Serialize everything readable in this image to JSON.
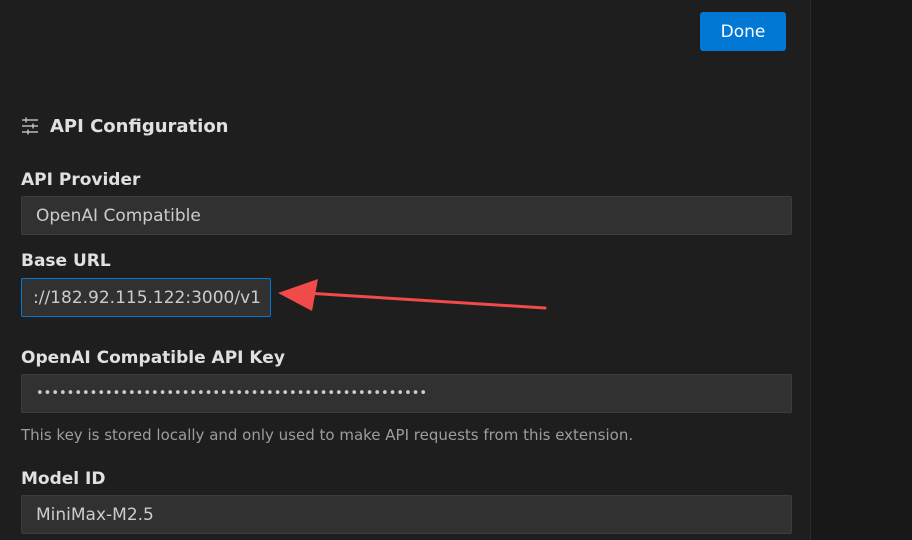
{
  "header": {
    "done_label": "Done"
  },
  "section": {
    "icon": "sliders-icon",
    "title": "API Configuration"
  },
  "fields": {
    "provider": {
      "label": "API Provider",
      "value": "OpenAI Compatible"
    },
    "base_url": {
      "label": "Base URL",
      "value": "://182.92.115.122:3000/v1"
    },
    "api_key": {
      "label": "OpenAI Compatible API Key",
      "value": "•••••••••••••••••••••••••••••••••••••••••••••••••••",
      "help": "This key is stored locally and only used to make API requests from this extension."
    },
    "model_id": {
      "label": "Model ID",
      "value": "MiniMax-M2.5"
    }
  },
  "colors": {
    "accent": "#0078d4",
    "annotation_arrow": "#f04a4a",
    "background": "#1e1e1e",
    "input_bg": "#313131"
  }
}
